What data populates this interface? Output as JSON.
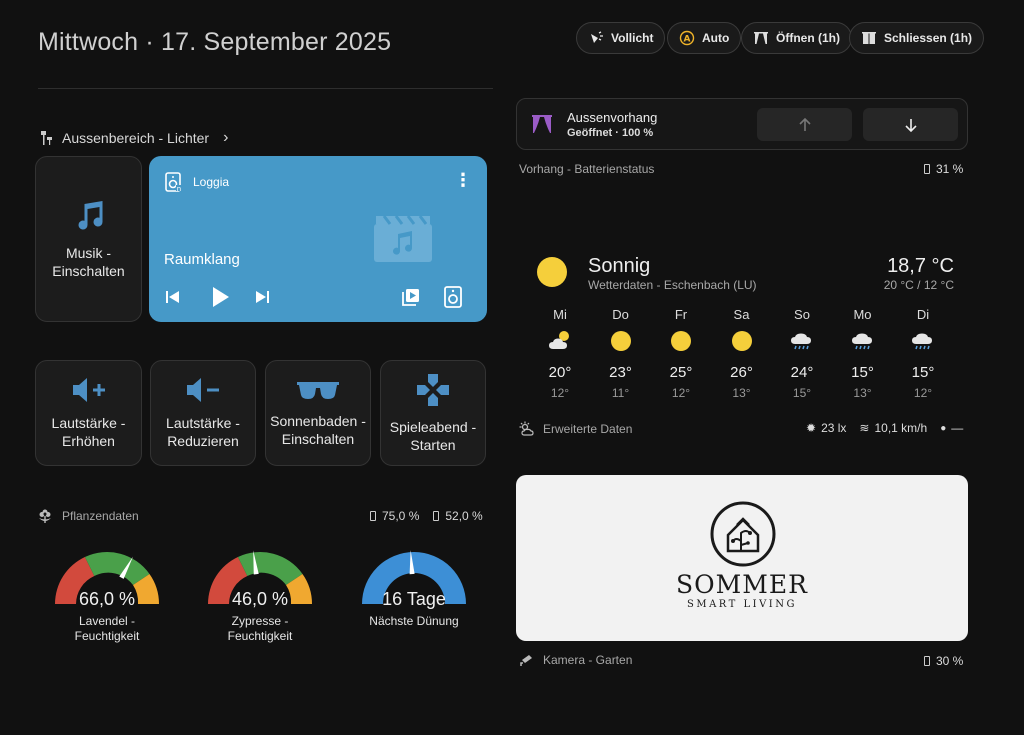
{
  "header": {
    "date_title": "Mittwoch · 17. September 2025",
    "chips": [
      {
        "label": "Vollicht",
        "icon": "light-burst-icon"
      },
      {
        "label": "Auto",
        "icon": "auto-mode-icon"
      },
      {
        "label": "Öffnen (1h)",
        "icon": "curtains-open-icon"
      },
      {
        "label": "Schliessen (1h)",
        "icon": "curtains-closed-icon"
      }
    ]
  },
  "lights": {
    "section_title": "Aussenbereich - Lichter"
  },
  "music_button": {
    "label_line1": "Musik -",
    "label_line2": "Einschalten"
  },
  "media_player": {
    "room": "Loggia",
    "source": "Raumklang",
    "bg_color": "#4699c8"
  },
  "actions": [
    {
      "line1": "Lautstärke -",
      "line2": "Erhöhen",
      "icon": "volume-up-icon"
    },
    {
      "line1": "Lautstärke -",
      "line2": "Reduzieren",
      "icon": "volume-down-icon"
    },
    {
      "line1": "Sonnenbaden -",
      "line2": "Einschalten",
      "icon": "sunglasses-icon"
    },
    {
      "line1": "Spieleabend -",
      "line2": "Starten",
      "icon": "gamepad-icon"
    }
  ],
  "plants": {
    "section_title": "Pflanzendaten",
    "battery1": "75,0 %",
    "battery2": "52,0 %",
    "gauges": [
      {
        "value_text": "66,0 %",
        "value": 66,
        "label_line1": "Lavendel -",
        "label_line2": "Feuchtigkeit"
      },
      {
        "value_text": "46,0 %",
        "value": 46,
        "label_line1": "Zypresse -",
        "label_line2": "Feuchtigkeit"
      },
      {
        "value_text": "16 Tage",
        "value": 0.48,
        "label_line1": "Nächste Dünung",
        "label_line2": ""
      }
    ]
  },
  "curtain": {
    "name": "Aussenvorhang",
    "state": "Geöffnet · 100 %",
    "battery_label": "Vorhang - Batterienstatus",
    "battery_value": "31 %"
  },
  "weather": {
    "condition": "Sonnig",
    "location": "Wetterdaten - Eschenbach (LU)",
    "temperature": "18,7 °C",
    "hi_lo": "20 °C / 12 °C",
    "forecast": [
      {
        "day": "Mi",
        "hi": "20°",
        "lo": "12°",
        "icon": "partly-cloudy-icon"
      },
      {
        "day": "Do",
        "hi": "23°",
        "lo": "11°",
        "icon": "sun-icon"
      },
      {
        "day": "Fr",
        "hi": "25°",
        "lo": "12°",
        "icon": "sun-icon"
      },
      {
        "day": "Sa",
        "hi": "26°",
        "lo": "13°",
        "icon": "sun-icon"
      },
      {
        "day": "So",
        "hi": "24°",
        "lo": "15°",
        "icon": "rain-cloud-icon"
      },
      {
        "day": "Mo",
        "hi": "15°",
        "lo": "13°",
        "icon": "rain-cloud-icon"
      },
      {
        "day": "Di",
        "hi": "15°",
        "lo": "12°",
        "icon": "rain-cloud-icon"
      }
    ],
    "extended_label": "Erweiterte Daten",
    "illuminance": "23 lx",
    "wind": "10,1 km/h",
    "humidity": "—"
  },
  "camera": {
    "brand": "SOMMER",
    "tagline": "SMART LIVING",
    "label": "Kamera - Garten",
    "battery": "30 %"
  }
}
